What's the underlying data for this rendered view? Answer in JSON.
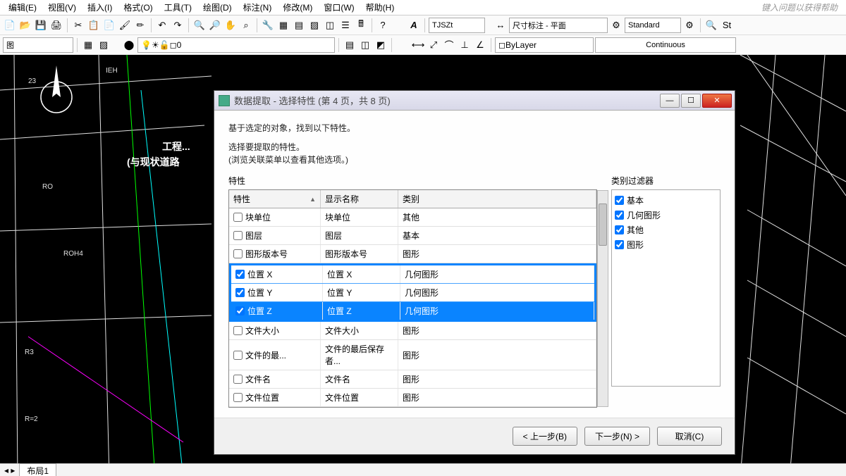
{
  "menubar": {
    "items": [
      "编辑(E)",
      "视图(V)",
      "插入(I)",
      "格式(O)",
      "工具(T)",
      "绘图(D)",
      "标注(N)",
      "修改(M)",
      "窗口(W)",
      "帮助(H)"
    ],
    "search_placeholder": "键入问题以获得帮助"
  },
  "toolbar1": {
    "style_combo": "TJSZt",
    "dim_combo": "尺寸标注 - 平面",
    "std_combo": "Standard"
  },
  "toolbar2": {
    "layer_combo": "0",
    "bylayer_combo": "ByLayer",
    "linetype_combo": "Continuous"
  },
  "canvas": {
    "label1": "工程...",
    "label2": "(与现状道路"
  },
  "dialog": {
    "title": "数据提取 - 选择特性 (第 4 页，共 8 页)",
    "intro": "基于选定的对象，找到以下特性。",
    "sub1": "选择要提取的特性。",
    "sub2": "(浏览关联菜单以查看其他选项。)",
    "attr_group": "特性",
    "filter_group": "类别过滤器",
    "columns": {
      "c1": "特性",
      "c2": "显示名称",
      "c3": "类别"
    },
    "rows": [
      {
        "checked": false,
        "c1": "块单位",
        "c2": "块单位",
        "c3": "其他",
        "hl": ""
      },
      {
        "checked": false,
        "c1": "图层",
        "c2": "图层",
        "c3": "基本",
        "hl": ""
      },
      {
        "checked": false,
        "c1": "图形版本号",
        "c2": "图形版本号",
        "c3": "图形",
        "hl": ""
      },
      {
        "checked": true,
        "c1": "位置 X",
        "c2": "位置 X",
        "c3": "几何图形",
        "hl": "group"
      },
      {
        "checked": true,
        "c1": "位置 Y",
        "c2": "位置 Y",
        "c3": "几何图形",
        "hl": "group"
      },
      {
        "checked": true,
        "c1": "位置 Z",
        "c2": "位置 Z",
        "c3": "几何图形",
        "hl": "active"
      },
      {
        "checked": false,
        "c1": "文件大小",
        "c2": "文件大小",
        "c3": "图形",
        "hl": ""
      },
      {
        "checked": false,
        "c1": "文件的最...",
        "c2": "文件的最后保存者...",
        "c3": "图形",
        "hl": ""
      },
      {
        "checked": false,
        "c1": "文件名",
        "c2": "文件名",
        "c3": "图形",
        "hl": ""
      },
      {
        "checked": false,
        "c1": "文件位置",
        "c2": "文件位置",
        "c3": "图形",
        "hl": ""
      }
    ],
    "filters": [
      {
        "label": "基本",
        "checked": true
      },
      {
        "label": "几何图形",
        "checked": true
      },
      {
        "label": "其他",
        "checked": true
      },
      {
        "label": "图形",
        "checked": true
      }
    ],
    "buttons": {
      "back": "< 上一步(B)",
      "next": "下一步(N) >",
      "cancel": "取消(C)"
    }
  },
  "status": {
    "tab": "布局1"
  }
}
